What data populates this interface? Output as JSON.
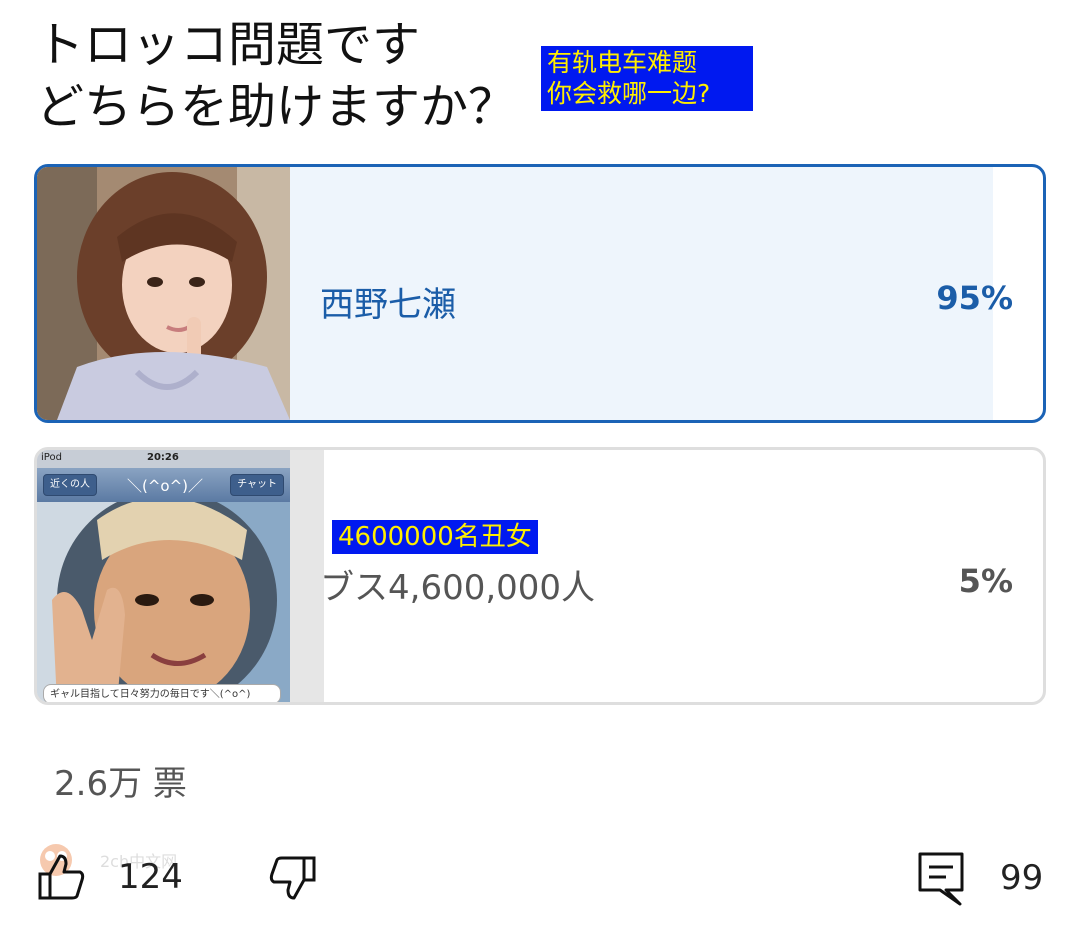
{
  "poll": {
    "question_line1": "トロッコ問題です",
    "question_line2": "どちらを助けますか？",
    "translation_line1": "有轨电车难题",
    "translation_line2": "你会救哪一边?"
  },
  "options": [
    {
      "label": "西野七瀬",
      "percent_text": "95%",
      "percent": 95,
      "selected": true
    },
    {
      "label": "ブス4,600,000人",
      "percent_text": "5%",
      "percent": 5,
      "selected": false,
      "note": "4600000名丑女",
      "photo_status_left": "iPod",
      "photo_status_time": "20:26",
      "photo_back_button": "近くの人",
      "photo_title": "＼(^o^)／",
      "photo_chat_button": "チャット",
      "photo_caption": "ギャル目指して日々努力の毎日です＼(^o^)"
    }
  ],
  "total_votes": "2.6万 票",
  "actions": {
    "like_count": "124",
    "comment_count": "99"
  },
  "watermark": "2ch中文网",
  "colors": {
    "accent": "#1b63b6",
    "note_bg": "#0019f0",
    "note_text": "#ffee00"
  }
}
